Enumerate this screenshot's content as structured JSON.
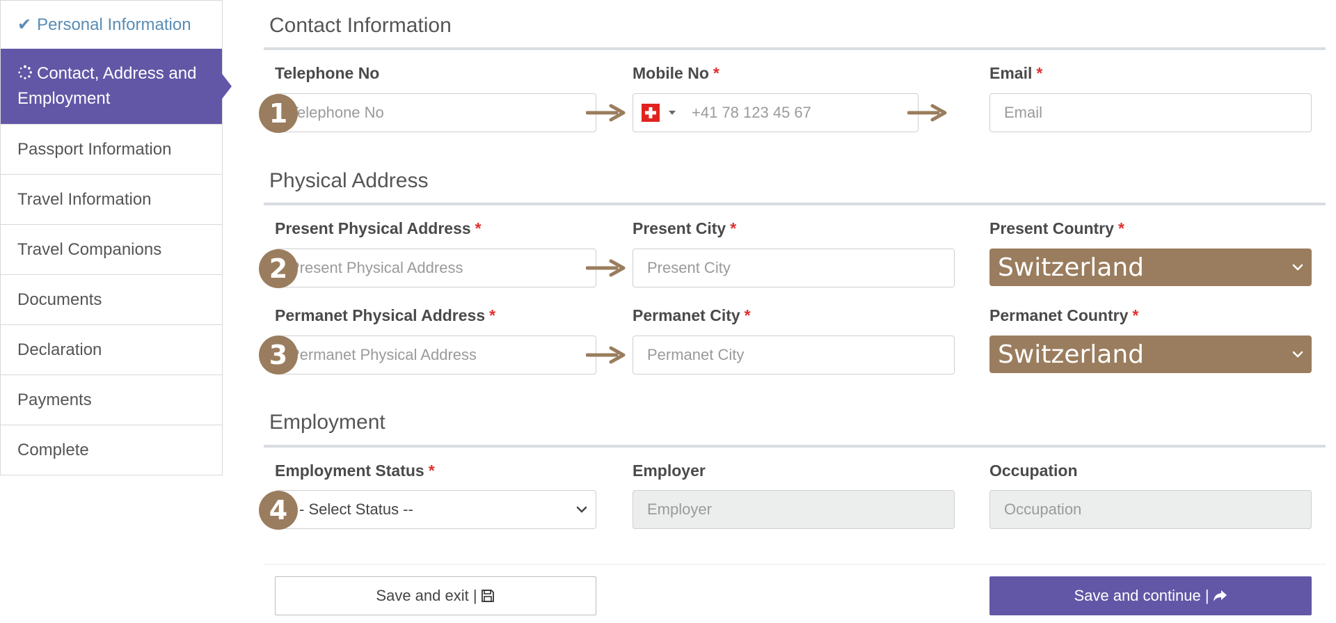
{
  "sidebar": {
    "items": [
      {
        "label": "Personal Information",
        "state": "done",
        "icon": "check-icon"
      },
      {
        "label": "Contact, Address and Employment",
        "state": "active",
        "icon": "spinner-icon"
      },
      {
        "label": "Passport Information"
      },
      {
        "label": "Travel Information"
      },
      {
        "label": "Travel Companions"
      },
      {
        "label": "Documents"
      },
      {
        "label": "Declaration"
      },
      {
        "label": "Payments"
      },
      {
        "label": "Complete"
      }
    ]
  },
  "contact": {
    "title": "Contact Information",
    "telephone": {
      "label": "Telephone No",
      "placeholder": "Telephone No"
    },
    "mobile": {
      "label": "Mobile No",
      "required": "*",
      "placeholder": "+41 78 123 45 67",
      "flag": "switzerland-flag-icon"
    },
    "email": {
      "label": "Email",
      "required": "*",
      "placeholder": "Email"
    }
  },
  "address": {
    "title": "Physical Address",
    "present_address": {
      "label": "Present Physical Address",
      "required": "*",
      "placeholder": "Present Physical Address"
    },
    "present_city": {
      "label": "Present City",
      "required": "*",
      "placeholder": "Present City"
    },
    "present_country": {
      "label": "Present Country",
      "required": "*",
      "value": "Switzerland"
    },
    "permanent_address": {
      "label": "Permanet Physical Address",
      "required": "*",
      "placeholder": "Permanet Physical Address"
    },
    "permanent_city": {
      "label": "Permanet City",
      "required": "*",
      "placeholder": "Permanet City"
    },
    "permanent_country": {
      "label": "Permanet Country",
      "required": "*",
      "value": "Switzerland"
    }
  },
  "employment": {
    "title": "Employment",
    "status": {
      "label": "Employment Status",
      "required": "*",
      "value": "- Select Status --"
    },
    "employer": {
      "label": "Employer",
      "placeholder": "Employer"
    },
    "occupation": {
      "label": "Occupation",
      "placeholder": "Occupation"
    }
  },
  "badges": [
    "1",
    "2",
    "3",
    "4"
  ],
  "buttons": {
    "save_exit": "Save and exit |",
    "save_continue": "Save and continue |"
  },
  "colors": {
    "primary": "#6257a6",
    "accent": "#9a7d5e",
    "required": "#e0302f",
    "done": "#5a8cb4"
  }
}
